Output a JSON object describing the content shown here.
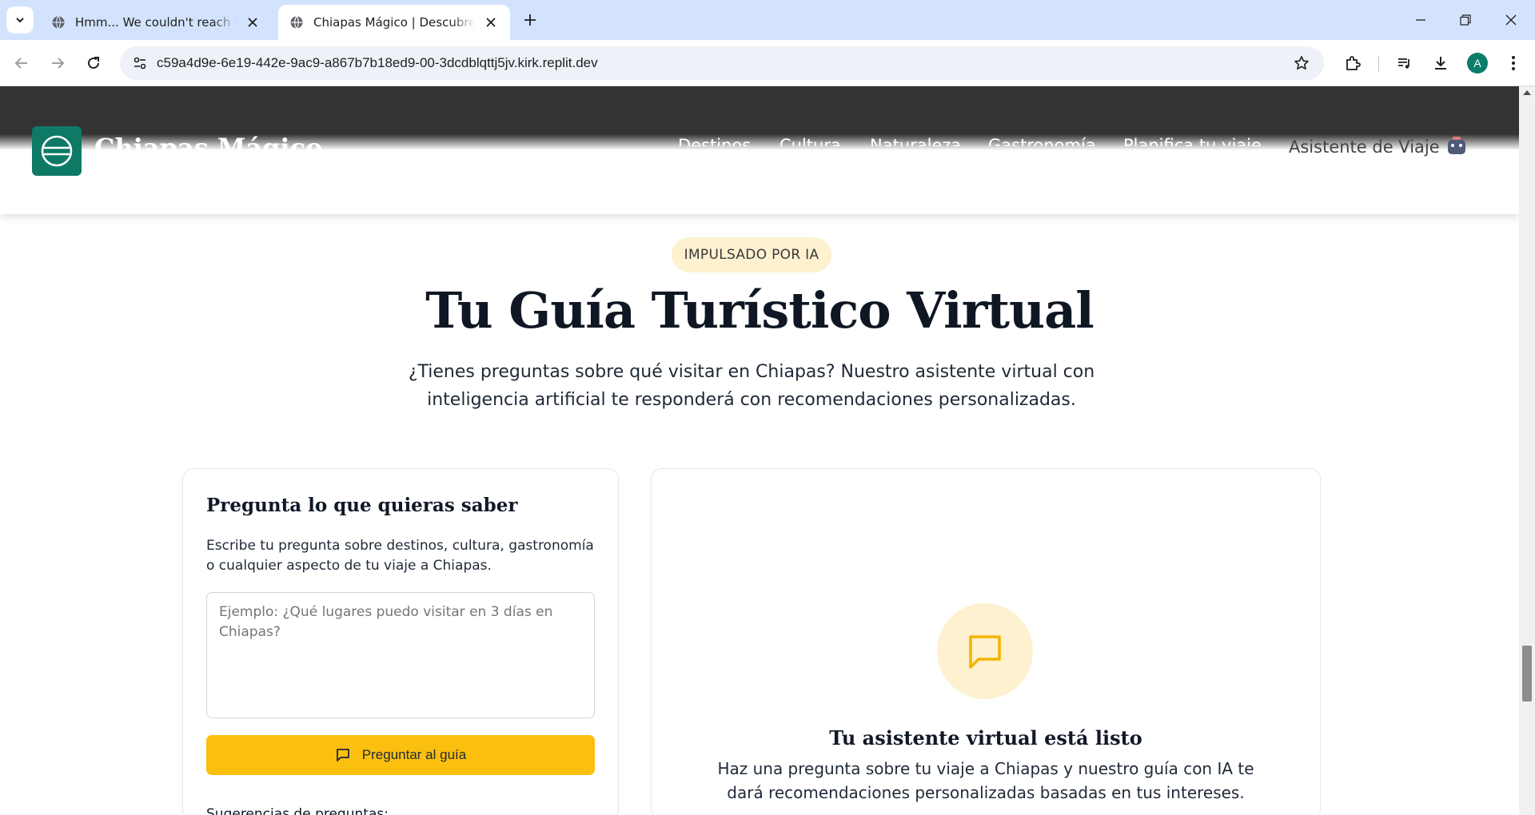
{
  "browser": {
    "tabs": [
      {
        "title": "Hmm... We couldn't reach this app",
        "active": false
      },
      {
        "title": "Chiapas Mágico | Descubre la magia de Chiapas",
        "active": true
      }
    ],
    "url": "c59a4d9e-6e19-442e-9ac9-a867b7b18ed9-00-3dcdblqttj5jv.kirk.replit.dev",
    "profile_initial": "A"
  },
  "header": {
    "brand": "Chiapas Mágico",
    "nav": [
      "Destinos",
      "Cultura",
      "Naturaleza",
      "Gastronomía",
      "Planifica tu viaje"
    ],
    "assistant_link": "Asistente de Viaje"
  },
  "hero": {
    "badge": "IMPULSADO POR IA",
    "title": "Tu Guía Turístico Virtual",
    "subtitle": "¿Tienes preguntas sobre qué visitar en Chiapas? Nuestro asistente virtual con inteligencia artificial te responderá con recomendaciones personalizadas."
  },
  "question_card": {
    "title": "Pregunta lo que quieras saber",
    "description": "Escribe tu pregunta sobre destinos, cultura, gastronomía o cualquier aspecto de tu viaje a Chiapas.",
    "placeholder": "Ejemplo: ¿Qué lugares puedo visitar en 3 días en Chiapas?",
    "button_label": "Preguntar al guía",
    "suggestions_label": "Sugerencias de preguntas:"
  },
  "answer_card": {
    "title": "Tu asistente virtual está listo",
    "description": "Haz una pregunta sobre tu viaje a Chiapas y nuestro guía con IA te dará recomendaciones personalizadas basadas en tus intereses."
  },
  "colors": {
    "accent": "#fbbf0f",
    "accent_soft": "#fdf1cf",
    "brand_green": "#0e7a66",
    "header_dark": "#333333"
  }
}
